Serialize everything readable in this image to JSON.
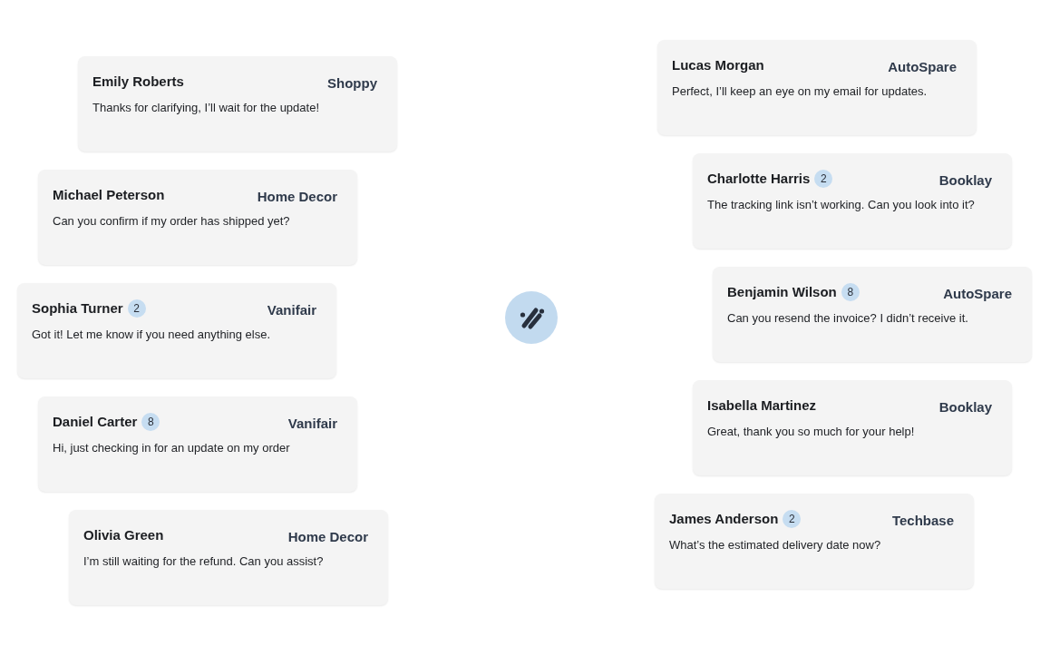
{
  "left_conversations": [
    {
      "name": "Emily Roberts",
      "store": "Shoppy",
      "message": "Thanks for clarifying, I’ll wait for the update!"
    },
    {
      "name": "Michael Peterson",
      "store": "Home Decor",
      "message": "Can you confirm if my order has shipped yet?"
    },
    {
      "name": "Sophia Turner",
      "badge": "2",
      "store": "Vanifair",
      "message": "Got it! Let me know if you need anything else."
    },
    {
      "name": "Daniel Carter",
      "badge": "8",
      "store": "Vanifair",
      "message": "Hi, just checking in for an update on my order"
    },
    {
      "name": "Olivia Green",
      "store": "Home Decor",
      "message": "I’m still waiting for the refund. Can you assist?"
    }
  ],
  "right_conversations": [
    {
      "name": "Lucas Morgan",
      "store": "AutoSpare",
      "message": "Perfect, I’ll keep an eye on my email for updates."
    },
    {
      "name": "Charlotte Harris",
      "badge": "2",
      "store": "Booklay",
      "message": "The tracking link isn’t working. Can you look into it?"
    },
    {
      "name": "Benjamin Wilson",
      "badge": "8",
      "store": "AutoSpare",
      "message": "Can you resend the invoice? I didn’t receive it."
    },
    {
      "name": "Isabella Martinez",
      "store": "Booklay",
      "message": "Great, thank you so much for your help!"
    },
    {
      "name": "James Anderson",
      "badge": "2",
      "store": "Techbase",
      "message": "What’s the estimated delivery date now?"
    }
  ]
}
